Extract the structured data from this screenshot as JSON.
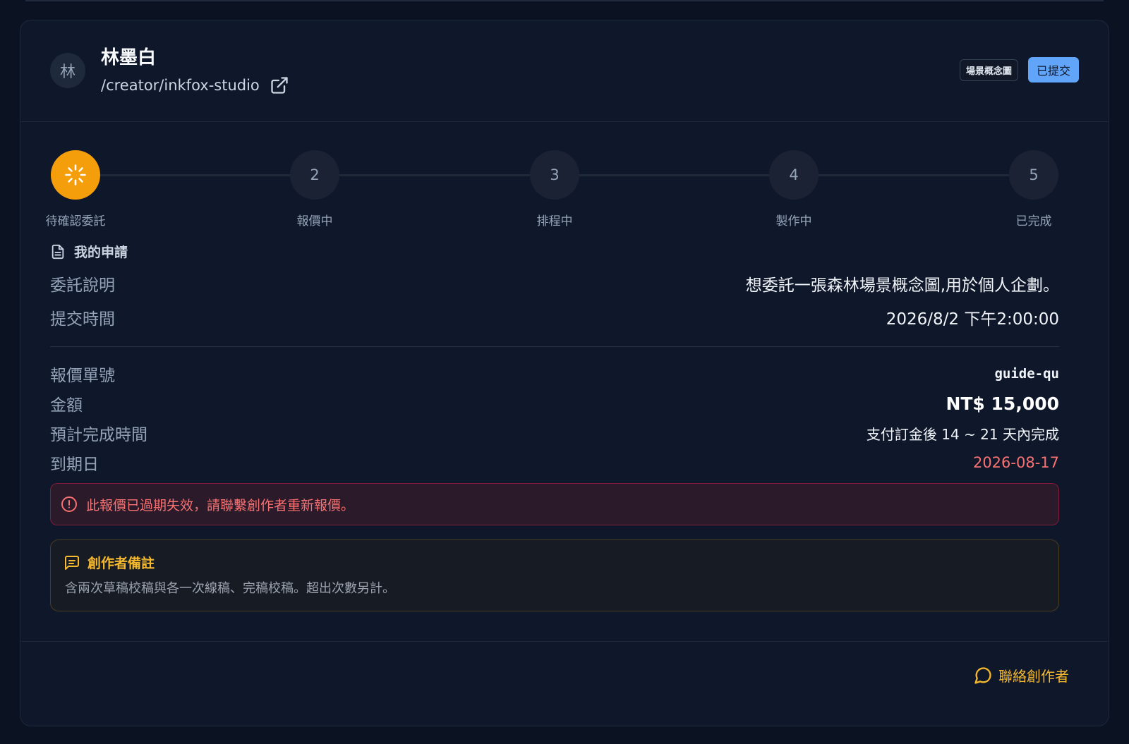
{
  "creator": {
    "avatar_initial": "林",
    "name": "林墨白",
    "path": "/creator/inkfox-studio"
  },
  "tags": {
    "category": "場景概念圖",
    "status": "已提交"
  },
  "colors": {
    "accent": "#f59e0b",
    "status_badge": "#60a5fa",
    "danger": "#f87171"
  },
  "stepper": {
    "active_index": 0,
    "steps": [
      {
        "number": "",
        "label": "待確認委託"
      },
      {
        "number": "2",
        "label": "報價中"
      },
      {
        "number": "3",
        "label": "排程中"
      },
      {
        "number": "4",
        "label": "製作中"
      },
      {
        "number": "5",
        "label": "已完成"
      }
    ]
  },
  "application": {
    "section_title": "我的申請",
    "description_label": "委託說明",
    "description_value": "想委託一張森林場景概念圖,用於個人企劃。",
    "submitted_label": "提交時間",
    "submitted_value": "2026/8/2 下午2:00:00"
  },
  "quote": {
    "id_label": "報價單號",
    "id_value": "guide-qu",
    "amount_label": "金額",
    "amount_value": "NT$ 15,000",
    "eta_label": "預計完成時間",
    "eta_value": "支付訂金後 14 ~ 21 天內完成",
    "due_label": "到期日",
    "due_value": "2026-08-17"
  },
  "alert": {
    "message": "此報價已過期失效，請聯繫創作者重新報價。"
  },
  "note": {
    "title": "創作者備註",
    "body": "含兩次草稿校稿與各一次線稿、完稿校稿。超出次數另計。"
  },
  "footer": {
    "contact_label": "聯絡創作者"
  }
}
